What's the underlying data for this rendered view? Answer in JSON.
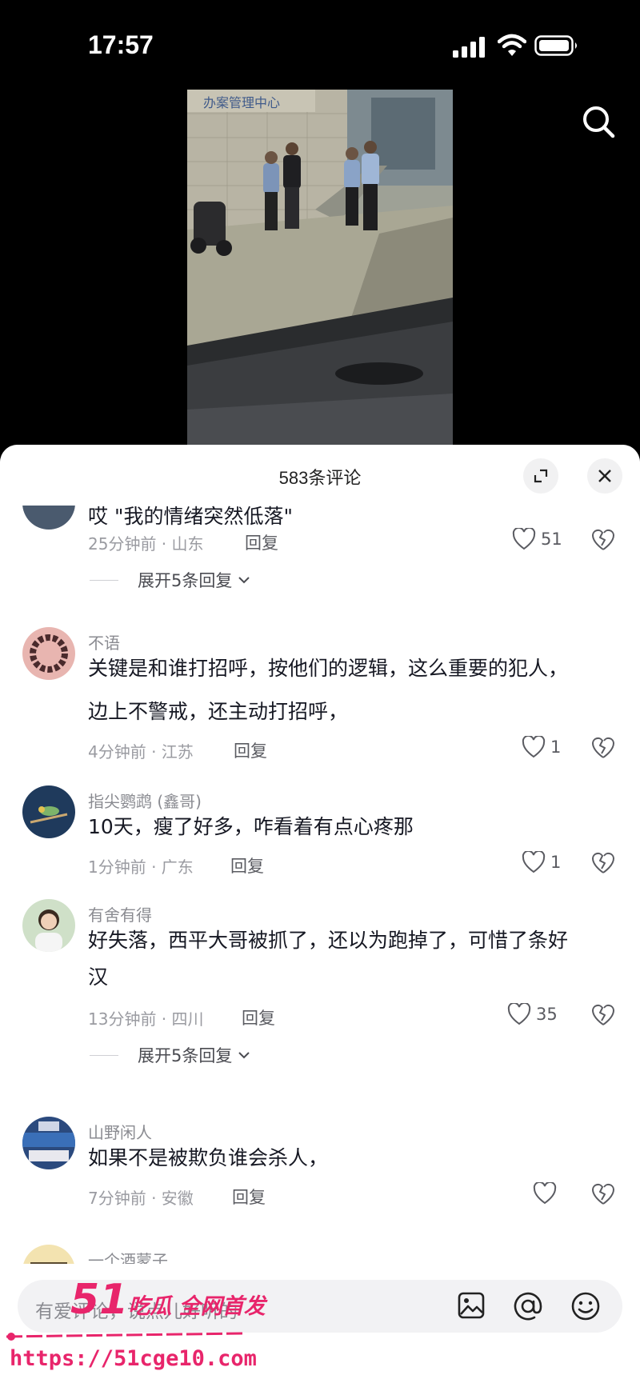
{
  "status_bar": {
    "time": "17:57"
  },
  "video": {
    "search_icon": "search-icon"
  },
  "comments_panel": {
    "title": "583条评论",
    "expand_icon": "expand-icon",
    "close_icon": "close-icon",
    "partial_comment": {
      "text": "哎 \"我的情绪突然低落\"",
      "time_location": "25分钟前 · 山东",
      "reply_label": "回复",
      "likes": "51",
      "expand_replies": "展开5条回复"
    },
    "comments": [
      {
        "username": "不语",
        "text_line1": "关键是和谁打招呼，按他们的逻辑，这么重要的犯人，",
        "text_line2": "边上不警戒，还主动打招呼，",
        "time_location": "4分钟前 · 江苏",
        "reply_label": "回复",
        "likes": "1"
      },
      {
        "username": "指尖鹦鹉 (鑫哥)",
        "text_line1": "10天，瘦了好多，咋看着有点心疼那",
        "time_location": "1分钟前 · 广东",
        "reply_label": "回复",
        "likes": "1"
      },
      {
        "username": "有舍有得",
        "text_line1": "好失落，西平大哥被抓了，还以为跑掉了，可惜了条好",
        "text_line2": "汉",
        "time_location": "13分钟前 · 四川",
        "reply_label": "回复",
        "likes": "35",
        "expand_replies": "展开5条回复"
      },
      {
        "username": "山野闲人",
        "text_line1": "如果不是被欺负谁会杀人，",
        "time_location": "7分钟前 · 安徽",
        "reply_label": "回复",
        "likes": ""
      },
      {
        "username": "一个酒蒙子"
      }
    ]
  },
  "input_bar": {
    "placeholder": "有爱评论，说点儿好听的",
    "image_icon": "image-icon",
    "mention_icon": "at-icon",
    "emoji_icon": "emoji-icon"
  },
  "watermark": {
    "logo_number": "51",
    "logo_text": "吃瓜 全网首发",
    "url": "https://51cge10.com"
  },
  "colors": {
    "accent_watermark": "#e8256b",
    "text_primary": "#161823",
    "text_secondary": "#8a8b91"
  }
}
